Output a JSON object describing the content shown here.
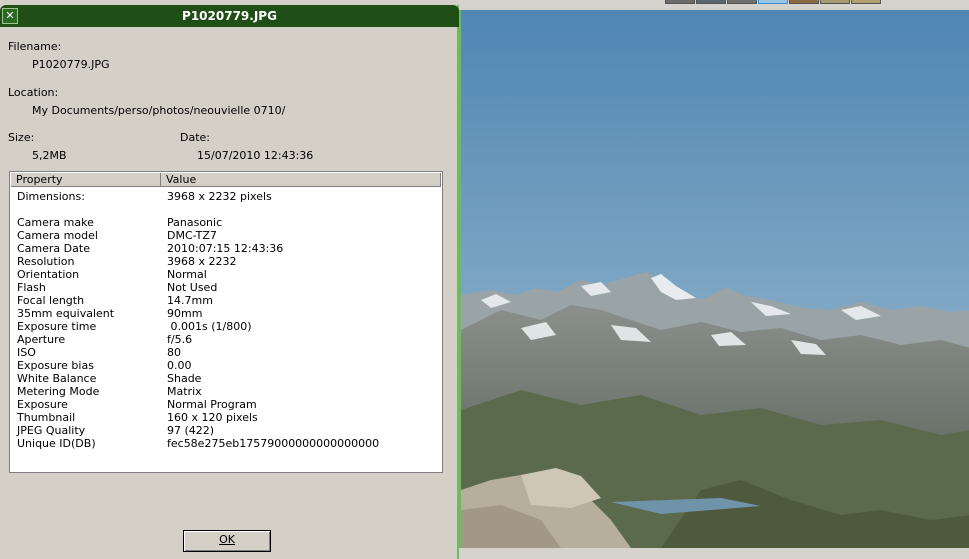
{
  "dialog": {
    "title": "P1020779.JPG",
    "filename_label": "Filename:",
    "filename_value": "P1020779.JPG",
    "location_label": "Location:",
    "location_value": "My Documents/perso/photos/neouvielle 0710/",
    "size_label": "Size:",
    "size_value": "5,2MB",
    "date_label": "Date:",
    "date_value": "15/07/2010 12:43:36",
    "ok_label": "OK"
  },
  "table": {
    "headers": [
      "Property",
      "Value"
    ],
    "rows": [
      {
        "k": "Dimensions:",
        "v": "3968 x 2232 pixels"
      },
      {
        "k": "Camera make",
        "v": "Panasonic"
      },
      {
        "k": "Camera model",
        "v": "DMC-TZ7"
      },
      {
        "k": "Camera Date",
        "v": "2010:07:15 12:43:36"
      },
      {
        "k": "Resolution",
        "v": "3968 x 2232"
      },
      {
        "k": "Orientation",
        "v": "Normal"
      },
      {
        "k": "Flash",
        "v": "Not Used"
      },
      {
        "k": "Focal length",
        "v": "14.7mm"
      },
      {
        "k": "35mm equivalent",
        "v": "90mm"
      },
      {
        "k": "Exposure time",
        "v": " 0.001s (1/800)"
      },
      {
        "k": "Aperture",
        "v": "f/5.6"
      },
      {
        "k": "ISO",
        "v": "80"
      },
      {
        "k": "Exposure bias",
        "v": "0.00"
      },
      {
        "k": "White Balance",
        "v": "Shade"
      },
      {
        "k": "Metering Mode",
        "v": "Matrix"
      },
      {
        "k": "Exposure",
        "v": "Normal Program"
      },
      {
        "k": "Thumbnail",
        "v": "160 x 120 pixels"
      },
      {
        "k": "JPEG Quality",
        "v": "97 (422)"
      },
      {
        "k": "Unique ID(DB)",
        "v": "fec58e275eb17579000000000000000"
      }
    ]
  },
  "colors": {
    "titlebar": "#1f4f17",
    "accent_border": "#6fba5f",
    "dialog_bg": "#d4d0c8"
  },
  "icons": {
    "close": "close-icon"
  }
}
